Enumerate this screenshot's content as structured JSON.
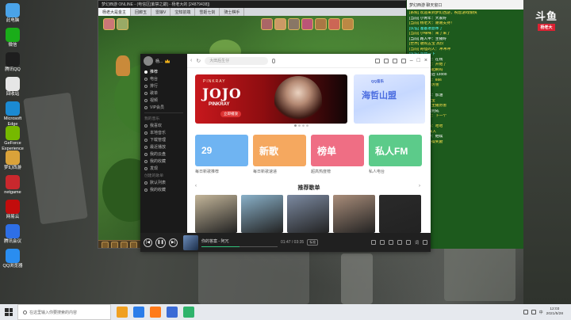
{
  "desktop": {
    "icons": [
      {
        "label": "此电脑",
        "color": "#4aa3e8"
      },
      {
        "label": "微信",
        "color": "#1aad19"
      },
      {
        "label": "腾讯QQ",
        "color": "#1e1e1e"
      },
      {
        "label": "回收站",
        "color": "#e6e6e6"
      },
      {
        "label": "Microsoft Edge",
        "color": "#1b8ad2"
      },
      {
        "label": "GeForce Experience",
        "color": "#76b900"
      },
      {
        "label": "梦幻西游",
        "color": "#d9a23a"
      },
      {
        "label": "netgame",
        "color": "#c9282d"
      },
      {
        "label": "网易云",
        "color": "#c20c0c"
      },
      {
        "label": "腾讯会议",
        "color": "#2e6fe6"
      },
      {
        "label": "QQ浏览器",
        "color": "#2a8df0"
      }
    ]
  },
  "game_window": {
    "title": "梦幻西游 ONLINE - (电信区[紫禁之巅] - 杨老大的 [24879438])",
    "tabs": [
      "杨老大是金主",
      "回廊玉",
      "雷娘V",
      "宝知前端",
      "雪姬七剑",
      "骑士棋手"
    ]
  },
  "music_app": {
    "user_name": "杨...",
    "sidebar": {
      "items": [
        "推荐",
        "电台",
        "排行",
        "歌单",
        "视频",
        "VIP会员"
      ],
      "section1": "我的音乐",
      "items2": [
        "我喜欢",
        "本地音乐",
        "下载管理",
        "最近播放",
        "我的云盘",
        "我的收藏",
        "发现"
      ],
      "section2": "创建的歌单",
      "items3": [
        "默认列表",
        "我的收藏"
      ]
    },
    "search_placeholder": "大田后生仔",
    "banner": {
      "brand": "PINKRAY",
      "title": "JOJO",
      "sub": "PINKRAY",
      "button": "立即播放"
    },
    "banner2": {
      "logo": "QQ音乐",
      "title": "海哲山盟"
    },
    "quick_cards": [
      {
        "text": "29",
        "label": "每日新歌推荐",
        "color": "#6fb4f2"
      },
      {
        "text": "新歌",
        "label": "每日新歌速递",
        "color": "#f5a85f"
      },
      {
        "text": "榜单",
        "label": "超高热度榜",
        "color": "#ef6e84"
      },
      {
        "text": "私人FM",
        "label": "私人电台",
        "color": "#5ccb8a"
      }
    ],
    "section_title": "推荐歌单",
    "playlist_colors": [
      "#c4b69a",
      "#8ab1c9",
      "#7c8aa1",
      "#a98d7a",
      "#2a2a2a"
    ],
    "player": {
      "song": "你的答案 - 阿冗",
      "time": "01:47 / 03:35",
      "quality": "标准",
      "lyric": "词",
      "progress": 0.5
    }
  },
  "chat": {
    "header": "梦幻西游 聊天窗口",
    "lines": [
      {
        "text": "[系统] 欢迎来到梦幻西游，祝您游戏愉快",
        "cls": ""
      },
      {
        "text": "[当前] 小青年：大家好",
        "cls": "white"
      },
      {
        "text": "[当前] 杨老大：谢谢支持！",
        "cls": ""
      },
      {
        "text": "[队伍] 准备进副本了",
        "cls": "cyan"
      },
      {
        "text": "[当前] 小咪咪：来了来了",
        "cls": ""
      },
      {
        "text": "[当前] 路人甲：主播好",
        "cls": "white"
      },
      {
        "text": "[世界] 收购五宝 高价",
        "cls": ""
      },
      {
        "text": "[当前] 奇怪的人：冲冲冲",
        "cls": ""
      },
      {
        "text": "[队伍] 等我一下",
        "cls": "cyan"
      },
      {
        "text": "[当前] 小星星：在线",
        "cls": "white"
      },
      {
        "text": "[当前] 杨老大：开始了",
        "cls": ""
      },
      {
        "text": "[世界] 有人一起刷吗",
        "cls": ""
      },
      {
        "text": "[系统] 获得经验 12000",
        "cls": "white"
      },
      {
        "text": "[当前] 大白菜：666",
        "cls": ""
      },
      {
        "text": "[当前] 龙猫：厉害",
        "cls": ""
      },
      {
        "text": "[队伍] 好的",
        "cls": "cyan"
      },
      {
        "text": "[当前] 小青年：加油",
        "cls": "white"
      },
      {
        "text": "[世界] 出售宝宝",
        "cls": ""
      },
      {
        "text": "[当前] 猎人：主播厉害",
        "cls": ""
      },
      {
        "text": "[系统] 任务已完成",
        "cls": "white"
      },
      {
        "text": "[当前] 杨老大：下一个",
        "cls": ""
      },
      {
        "text": "[队伍] 收到",
        "cls": "cyan"
      },
      {
        "text": "[当前] 小咪咪：哈哈",
        "cls": ""
      },
      {
        "text": "[世界] 组队 来人",
        "cls": ""
      },
      {
        "text": "[当前] 路人甲：继续",
        "cls": "white"
      },
      {
        "text": "[系统] 恭喜获得奖励",
        "cls": ""
      }
    ]
  },
  "streamer": {
    "logo_main": "斗鱼",
    "logo_sub": "杨老大"
  },
  "taskbar": {
    "search_placeholder": "在这里输入你要搜索的内容",
    "apps": [
      "#f0a020",
      "#2b7de9",
      "#ff7a1a",
      "#3b6bd6",
      "#2fb36b"
    ],
    "time": "12:03",
    "date": "2021/5/28",
    "lang": "中"
  }
}
